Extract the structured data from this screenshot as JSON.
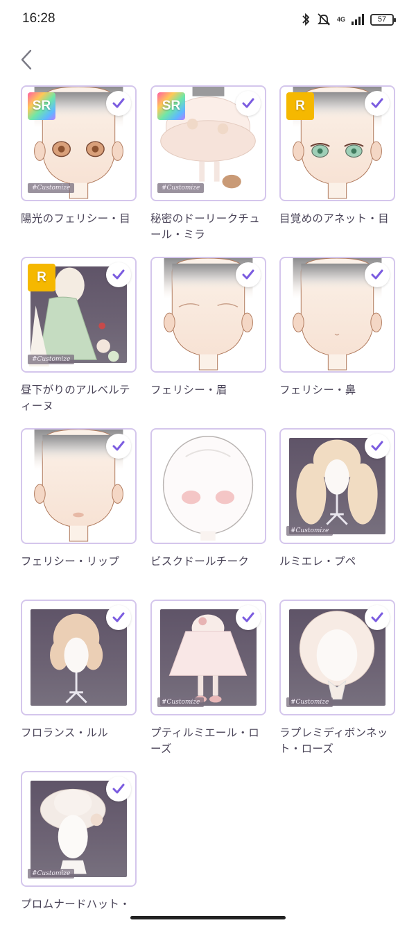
{
  "status_bar": {
    "time": "16:28",
    "network": "4G",
    "battery": "57",
    "icons": [
      "bluetooth-icon",
      "muted-bell-icon",
      "signal-icon",
      "battery-icon"
    ]
  },
  "nav": {
    "back_icon": "chevron-left-icon"
  },
  "colors": {
    "accent": "#7b5ce0",
    "border": "#d4c6ec",
    "text": "#4a4458"
  },
  "items": [
    {
      "name": "陽光のフェリシー・目",
      "rarity": "SR",
      "selected": true
    },
    {
      "name": "秘密のドーリークチュール・ミラ",
      "rarity": "SR",
      "selected": true
    },
    {
      "name": "目覚めのアネット・目",
      "rarity": "R",
      "selected": true
    },
    {
      "name": "昼下がりのアルベルティーヌ",
      "rarity": "R",
      "selected": true
    },
    {
      "name": "フェリシー・眉",
      "rarity": "",
      "selected": true
    },
    {
      "name": "フェリシー・鼻",
      "rarity": "",
      "selected": true
    },
    {
      "name": "フェリシー・リップ",
      "rarity": "",
      "selected": true
    },
    {
      "name": "ビスクドールチーク",
      "rarity": "",
      "selected": false
    },
    {
      "name": "ルミエレ・プペ",
      "rarity": "",
      "selected": true
    },
    {
      "name": "フロランス・ルル",
      "rarity": "",
      "selected": true
    },
    {
      "name": "プティルミエール・ローズ",
      "rarity": "",
      "selected": true
    },
    {
      "name": "ラプレミディボンネット・ローズ",
      "rarity": "",
      "selected": true
    },
    {
      "name": "プロムナードハット・",
      "rarity": "",
      "selected": true
    }
  ],
  "watermark": "#Customize"
}
